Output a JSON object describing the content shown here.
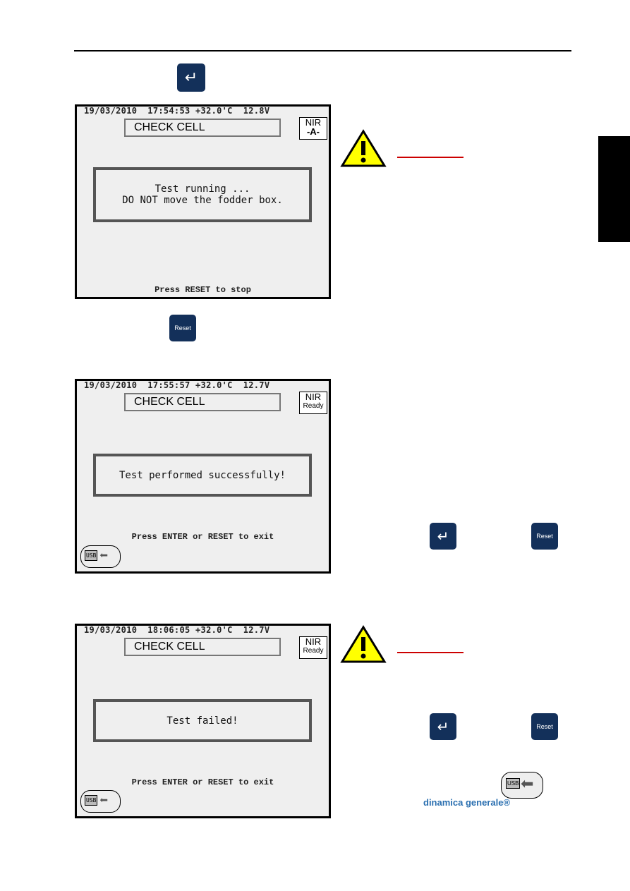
{
  "screens": [
    {
      "status": "19/03/2010  17:54:53 +32.0'C  12.8V",
      "title": "CHECK CELL",
      "nir_top": "NIR",
      "nir_bottom": "-A-",
      "message_line1": "Test running ...",
      "message_line2": "DO NOT move the fodder box.",
      "hint": "Press RESET to stop"
    },
    {
      "status": "19/03/2010  17:55:57 +32.0'C  12.7V",
      "title": "CHECK CELL",
      "nir_top": "NIR",
      "nir_bottom": "Ready",
      "message_line1": "Test performed successfully!",
      "hint": "Press ENTER or RESET to exit",
      "usb": "USB"
    },
    {
      "status": "19/03/2010  18:06:05 +32.0'C  12.7V",
      "title": "CHECK CELL",
      "nir_top": "NIR",
      "nir_bottom": "Ready",
      "message_line1": "Test failed!",
      "hint": "Press ENTER or RESET to exit",
      "usb": "USB"
    }
  ],
  "keys": {
    "enter": "↵",
    "reset": "Reset"
  },
  "usb_label": "USB",
  "logo": "dinamica generale®",
  "colors": {
    "key": "#13305a",
    "warning": "#ffff00",
    "underline": "#cc0000",
    "logo": "#2a6fb0"
  }
}
